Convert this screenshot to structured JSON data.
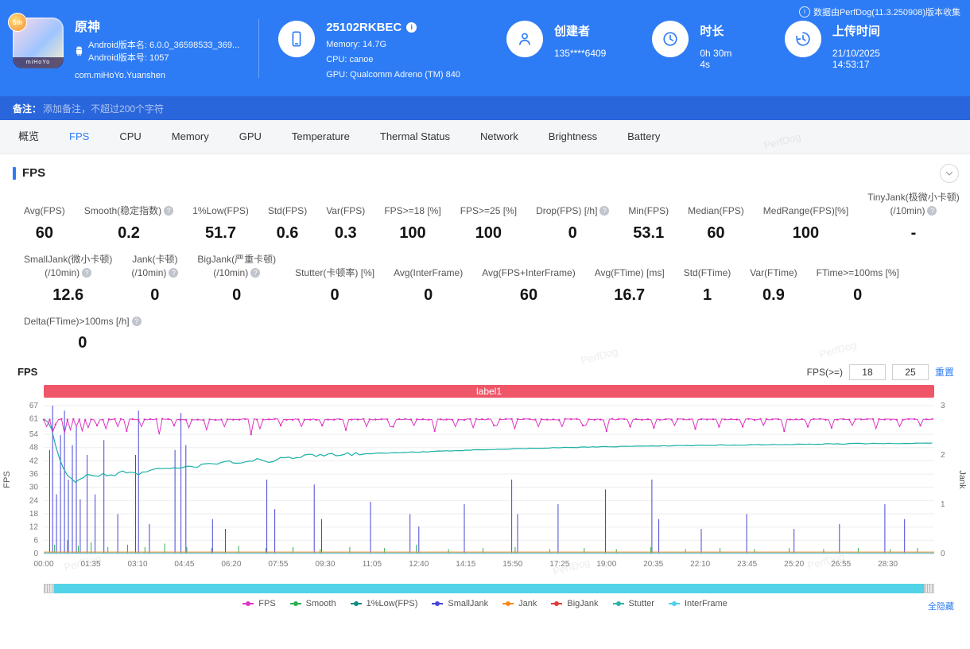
{
  "header": {
    "app": {
      "name": "原神",
      "badge_top": "5th",
      "badge_bottom": "miHoYo",
      "android_version_name": "Android版本名: 6.0.0_36598533_369...",
      "android_version_code": "Android版本号: 1057",
      "package": "com.miHoYo.Yuanshen"
    },
    "device": {
      "model": "25102RKBEC",
      "memory": "Memory: 14.7G",
      "cpu": "CPU: canoe",
      "gpu": "GPU: Qualcomm Adreno (TM) 840"
    },
    "creator": {
      "label": "创建者",
      "value": "135****6409"
    },
    "duration": {
      "label": "时长",
      "value": "0h 30m 4s"
    },
    "upload": {
      "label": "上传时间",
      "value": "21/10/2025 14:53:17"
    },
    "collector_note": "数据由PerfDog(11.3.250908)版本收集"
  },
  "note_bar": {
    "label": "备注：",
    "placeholder": "添加备注，不超过200个字符"
  },
  "tabs": [
    {
      "id": "overview",
      "label": "概览",
      "active": false
    },
    {
      "id": "fps",
      "label": "FPS",
      "active": true
    },
    {
      "id": "cpu",
      "label": "CPU",
      "active": false
    },
    {
      "id": "memory",
      "label": "Memory",
      "active": false
    },
    {
      "id": "gpu",
      "label": "GPU",
      "active": false
    },
    {
      "id": "temperature",
      "label": "Temperature",
      "active": false
    },
    {
      "id": "thermal-status",
      "label": "Thermal Status",
      "active": false
    },
    {
      "id": "network",
      "label": "Network",
      "active": false
    },
    {
      "id": "brightness",
      "label": "Brightness",
      "active": false
    },
    {
      "id": "battery",
      "label": "Battery",
      "active": false
    }
  ],
  "section": {
    "title": "FPS"
  },
  "stats": {
    "rows": [
      [
        {
          "label": "Avg(FPS)",
          "value": "60"
        },
        {
          "label": "Smooth(稳定指数)",
          "help": true,
          "value": "0.2"
        },
        {
          "label": "1%Low(FPS)",
          "value": "51.7"
        },
        {
          "label": "Std(FPS)",
          "value": "0.6"
        },
        {
          "label": "Var(FPS)",
          "value": "0.3"
        },
        {
          "label": "FPS>=18 [%]",
          "value": "100"
        },
        {
          "label": "FPS>=25 [%]",
          "value": "100"
        },
        {
          "label": "Drop(FPS) [/h]",
          "help": true,
          "value": "0"
        },
        {
          "label": "Min(FPS)",
          "value": "53.1"
        },
        {
          "label": "Median(FPS)",
          "value": "60"
        },
        {
          "label": "MedRange(FPS)[%]",
          "value": "100"
        },
        {
          "label": "TinyJank(极微小卡顿)",
          "label2": "(/10min)",
          "help": true,
          "value": "-"
        }
      ],
      [
        {
          "label": "SmallJank(微小卡顿)",
          "label2": "(/10min)",
          "help": true,
          "value": "12.6"
        },
        {
          "label": "Jank(卡顿)",
          "label2": "(/10min)",
          "help": true,
          "value": "0"
        },
        {
          "label": "BigJank(严重卡顿)",
          "label2": "(/10min)",
          "help": true,
          "value": "0"
        },
        {
          "label": "Stutter(卡顿率) [%]",
          "value": "0"
        },
        {
          "label": "Avg(InterFrame)",
          "value": "0"
        },
        {
          "label": "Avg(FPS+InterFrame)",
          "value": "60"
        },
        {
          "label": "Avg(FTime) [ms]",
          "value": "16.7"
        },
        {
          "label": "Std(FTime)",
          "value": "1"
        },
        {
          "label": "Var(FTime)",
          "value": "0.9"
        },
        {
          "label": "FTime>=100ms [%]",
          "value": "0"
        }
      ],
      [
        {
          "label": "Delta(FTime)>100ms [/h]",
          "help": true,
          "value": "0"
        }
      ]
    ]
  },
  "chart_controls": {
    "section_label": "FPS",
    "filter_label": "FPS(>=)",
    "min_value": "18",
    "max_value": "25",
    "reset_label": "重置"
  },
  "chart_data": {
    "type": "line",
    "label_bar": "label1",
    "duration_s": 1804,
    "seed": 20251021,
    "y_left": {
      "name": "FPS",
      "max": 67,
      "ticks": [
        0,
        6,
        12,
        18,
        24,
        30,
        36,
        42,
        48,
        54,
        61,
        67
      ]
    },
    "y_right": {
      "name": "Jank",
      "max": 3,
      "ticks": [
        0,
        1,
        2,
        3
      ]
    },
    "x_tick_interval_s": 95,
    "x_ticks": [
      "00:00",
      "01:35",
      "03:10",
      "04:45",
      "06:20",
      "07:55",
      "09:30",
      "11:05",
      "12:40",
      "14:15",
      "15:50",
      "17:25",
      "19:00",
      "20:35",
      "22:10",
      "23:45",
      "25:20",
      "26:55",
      "28:30"
    ],
    "series": {
      "fps": {
        "name": "FPS",
        "color": "#de35c3",
        "base": 61,
        "noise": 0.5,
        "dips": [
          [
            8,
            57.5
          ],
          [
            18,
            55
          ],
          [
            26,
            58.5
          ],
          [
            40,
            54.5
          ],
          [
            52,
            56
          ],
          [
            64,
            57.5
          ],
          [
            78,
            55.5
          ],
          [
            92,
            57
          ],
          [
            108,
            58
          ],
          [
            126,
            56.5
          ],
          [
            150,
            57.5
          ],
          [
            168,
            55.5
          ],
          [
            198,
            57.5
          ],
          [
            232,
            54
          ],
          [
            262,
            58
          ],
          [
            296,
            57
          ],
          [
            330,
            56
          ],
          [
            368,
            57.5
          ],
          [
            418,
            54
          ],
          [
            436,
            56.5
          ],
          [
            478,
            58
          ],
          [
            520,
            57.5
          ],
          [
            565,
            58
          ],
          [
            610,
            56
          ],
          [
            655,
            57.5
          ],
          [
            705,
            57.5
          ],
          [
            748,
            58
          ],
          [
            790,
            55.5
          ],
          [
            835,
            57.5
          ],
          [
            868,
            57
          ],
          [
            915,
            58
          ],
          [
            955,
            56.5
          ],
          [
            1000,
            57.5
          ],
          [
            1050,
            57.5
          ],
          [
            1095,
            58
          ],
          [
            1142,
            55.5
          ],
          [
            1190,
            57.5
          ],
          [
            1235,
            57
          ],
          [
            1280,
            58
          ],
          [
            1320,
            56.5
          ],
          [
            1370,
            57.5
          ],
          [
            1415,
            57.5
          ],
          [
            1460,
            58
          ],
          [
            1500,
            55.5
          ],
          [
            1548,
            57.5
          ],
          [
            1595,
            57
          ],
          [
            1640,
            58
          ],
          [
            1688,
            56.5
          ],
          [
            1732,
            57.5
          ],
          [
            1775,
            58
          ]
        ]
      },
      "low1": {
        "name": "1%Low(FPS)",
        "color": "#1ab0a6",
        "keyframes": [
          [
            0,
            61
          ],
          [
            15,
            57
          ],
          [
            30,
            44
          ],
          [
            45,
            36
          ],
          [
            60,
            32.5
          ],
          [
            75,
            34
          ],
          [
            90,
            35.5
          ],
          [
            105,
            34.5
          ],
          [
            120,
            36
          ],
          [
            140,
            35
          ],
          [
            160,
            37
          ],
          [
            185,
            36
          ],
          [
            210,
            37.5
          ],
          [
            240,
            38.5
          ],
          [
            270,
            38
          ],
          [
            300,
            39.5
          ],
          [
            335,
            40.5
          ],
          [
            370,
            41.5
          ],
          [
            400,
            41
          ],
          [
            430,
            42.5
          ],
          [
            460,
            42
          ],
          [
            490,
            43.5
          ],
          [
            520,
            44
          ],
          [
            560,
            44.5
          ],
          [
            600,
            44.8
          ],
          [
            650,
            45.2
          ],
          [
            700,
            45.6
          ],
          [
            760,
            46
          ],
          [
            820,
            46.5
          ],
          [
            880,
            47
          ],
          [
            950,
            47.4
          ],
          [
            1020,
            47.8
          ],
          [
            1100,
            48.2
          ],
          [
            1180,
            48.5
          ],
          [
            1260,
            48.8
          ],
          [
            1340,
            49
          ],
          [
            1420,
            49.2
          ],
          [
            1500,
            49.4
          ],
          [
            1580,
            49.6
          ],
          [
            1660,
            49.8
          ],
          [
            1740,
            49.9
          ],
          [
            1804,
            50
          ]
        ]
      },
      "smalljank": {
        "name": "SmallJank",
        "color": "#4545d8",
        "axis": "right",
        "spikes": [
          [
            12,
            2.1
          ],
          [
            18,
            3
          ],
          [
            26,
            1.2
          ],
          [
            34,
            2.4
          ],
          [
            42,
            2.9
          ],
          [
            50,
            1.5
          ],
          [
            58,
            2.2
          ],
          [
            66,
            2.6
          ],
          [
            74,
            1.1
          ],
          [
            88,
            2
          ],
          [
            104,
            1.2
          ],
          [
            122,
            2.3
          ],
          [
            150,
            0.8
          ],
          [
            186,
            2
          ],
          [
            192,
            2.9
          ],
          [
            214,
            0.6
          ],
          [
            266,
            2.1
          ],
          [
            278,
            2.85
          ],
          [
            288,
            2.2
          ],
          [
            342,
            0.7
          ],
          [
            368,
            0.5
          ],
          [
            452,
            1.5
          ],
          [
            468,
            0.9
          ],
          [
            548,
            1.4
          ],
          [
            563,
            0.7
          ],
          [
            662,
            1.05
          ],
          [
            742,
            0.8
          ],
          [
            760,
            0.55
          ],
          [
            852,
            1
          ],
          [
            948,
            1.5
          ],
          [
            960,
            0.8
          ],
          [
            1042,
            1
          ],
          [
            1138,
            1.3
          ],
          [
            1232,
            1.5
          ],
          [
            1246,
            0.7
          ],
          [
            1332,
            0.5
          ],
          [
            1424,
            0.8
          ],
          [
            1520,
            0.5
          ],
          [
            1612,
            0.6
          ],
          [
            1704,
            1
          ],
          [
            1744,
            0.7
          ]
        ]
      },
      "smooth": {
        "name": "Smooth",
        "color": "#2faf4f",
        "spikes": [
          [
            22,
            4
          ],
          [
            48,
            6
          ],
          [
            70,
            3.5
          ],
          [
            96,
            5
          ],
          [
            130,
            3
          ],
          [
            170,
            4
          ],
          [
            205,
            3
          ],
          [
            245,
            4.5
          ],
          [
            290,
            3
          ],
          [
            340,
            2.5
          ],
          [
            395,
            3.5
          ],
          [
            450,
            2.5
          ],
          [
            505,
            3
          ],
          [
            560,
            2
          ],
          [
            620,
            3
          ],
          [
            690,
            2.5
          ],
          [
            755,
            4
          ],
          [
            820,
            2
          ],
          [
            890,
            2.5
          ],
          [
            955,
            3
          ],
          [
            1025,
            2
          ],
          [
            1095,
            2.5
          ],
          [
            1160,
            2
          ],
          [
            1230,
            3
          ],
          [
            1300,
            2
          ],
          [
            1370,
            2.5
          ],
          [
            1440,
            2
          ],
          [
            1510,
            2.5
          ],
          [
            1580,
            2
          ],
          [
            1650,
            2.5
          ],
          [
            1715,
            2
          ],
          [
            1770,
            2.5
          ]
        ]
      },
      "jank": {
        "name": "Jank",
        "color": "#f5891d",
        "baseline_right": 0.03
      },
      "interframe": {
        "name": "InterFrame",
        "color": "#4ad2ea",
        "baseline_right": 0.012
      }
    }
  },
  "legend": {
    "hide_all": "全隐藏",
    "items": [
      {
        "label": "FPS",
        "color": "#de35c3"
      },
      {
        "label": "Smooth",
        "color": "#2faf4f"
      },
      {
        "label": "1%Low(FPS)",
        "color": "#0d8f85"
      },
      {
        "label": "SmallJank",
        "color": "#4545d8"
      },
      {
        "label": "Jank",
        "color": "#f5891d"
      },
      {
        "label": "BigJank",
        "color": "#e23a3a"
      },
      {
        "label": "Stutter",
        "color": "#2fb3a6"
      },
      {
        "label": "InterFrame",
        "color": "#4ad2ea"
      }
    ]
  },
  "watermark": {
    "text": "PerfDog"
  }
}
